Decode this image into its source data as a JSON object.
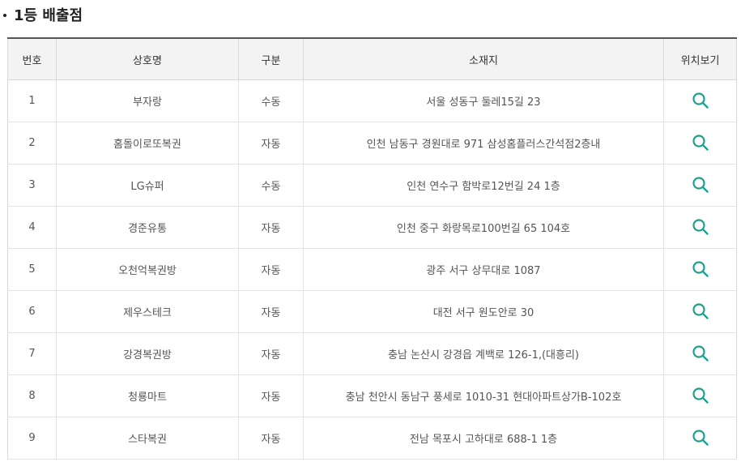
{
  "section": {
    "title": "1등 배출점"
  },
  "table": {
    "headers": {
      "no": "번호",
      "name": "상호명",
      "type": "구분",
      "address": "소재지",
      "location": "위치보기"
    },
    "rows": [
      {
        "no": "1",
        "name": "부자랑",
        "type": "수동",
        "address": "서울 성동구 둘레15길 23"
      },
      {
        "no": "2",
        "name": "홈돌이로또복권",
        "type": "자동",
        "address": "인천 남동구 경원대로 971 삼성홈플러스간석점2층내"
      },
      {
        "no": "3",
        "name": "LG슈퍼",
        "type": "수동",
        "address": "인천 연수구 함박로12번길 24 1층"
      },
      {
        "no": "4",
        "name": "경준유통",
        "type": "자동",
        "address": "인천 중구 화랑목로100번길 65 104호"
      },
      {
        "no": "5",
        "name": "오천억복권방",
        "type": "자동",
        "address": "광주 서구 상무대로 1087"
      },
      {
        "no": "6",
        "name": "제우스테크",
        "type": "자동",
        "address": "대전 서구 원도안로 30"
      },
      {
        "no": "7",
        "name": "강경복권방",
        "type": "자동",
        "address": "충남 논산시 강경읍 계백로 126-1,(대흥리)"
      },
      {
        "no": "8",
        "name": "청룡마트",
        "type": "자동",
        "address": "충남 천안시 동남구 풍세로 1010-31 현대아파트상가B-102호"
      },
      {
        "no": "9",
        "name": "스타복권",
        "type": "자동",
        "address": "전남 목포시 고하대로 688-1 1층"
      }
    ]
  },
  "icons": {
    "location": "search-icon"
  },
  "colors": {
    "icon": "#1e9e8e",
    "header_bg": "#f3f3f3",
    "top_border": "#555555"
  }
}
